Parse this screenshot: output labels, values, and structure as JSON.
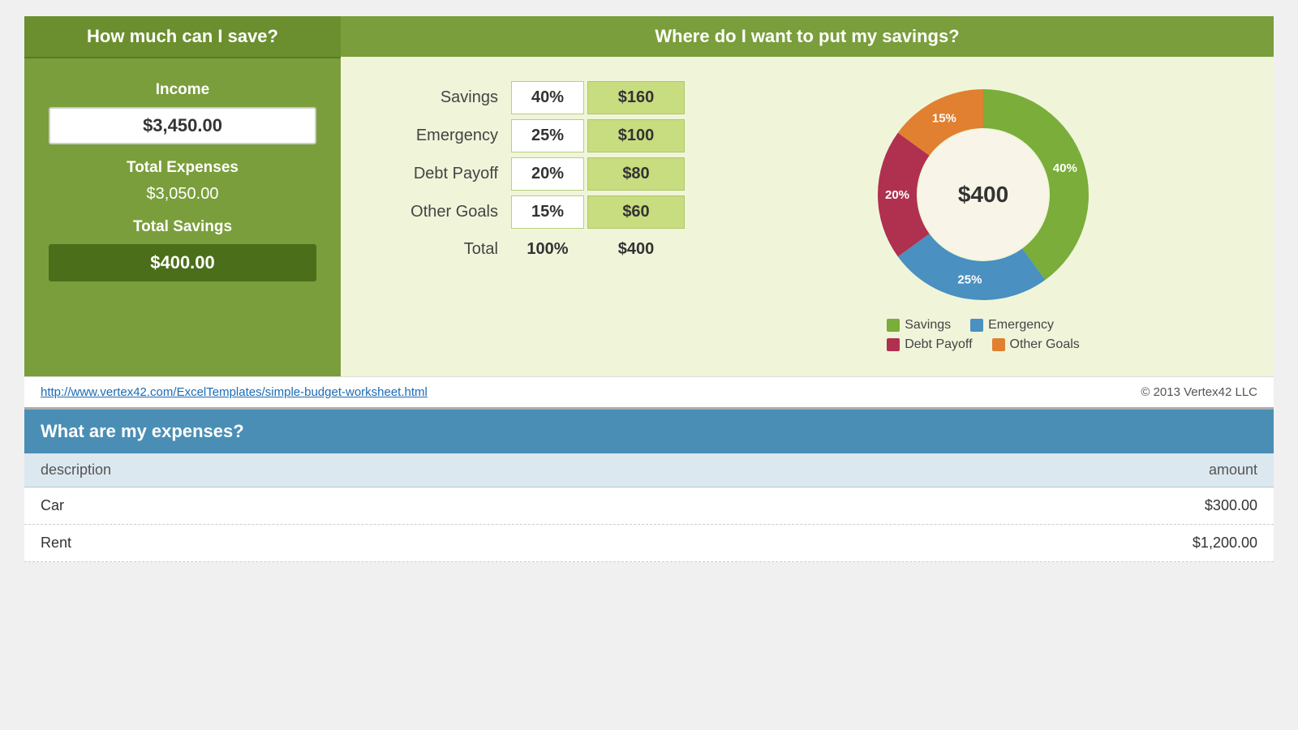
{
  "left_panel": {
    "header": "How much can I save?",
    "income_label": "Income",
    "income_value": "$3,450.00",
    "expenses_label": "Total Expenses",
    "expenses_value": "$3,050.00",
    "savings_label": "Total Savings",
    "savings_value": "$400.00"
  },
  "right_panel": {
    "header": "Where do I want to put my savings?",
    "rows": [
      {
        "label": "Savings",
        "pct": "40%",
        "amt": "$160"
      },
      {
        "label": "Emergency",
        "pct": "25%",
        "amt": "$100"
      },
      {
        "label": "Debt Payoff",
        "pct": "20%",
        "amt": "$80"
      },
      {
        "label": "Other Goals",
        "pct": "15%",
        "amt": "$60"
      },
      {
        "label": "Total",
        "pct": "100%",
        "amt": "$400"
      }
    ],
    "donut_center": "$400",
    "donut_segments": [
      {
        "label": "Savings",
        "pct": 40,
        "color": "#7aad3a",
        "pct_label": "40%"
      },
      {
        "label": "Emergency",
        "pct": 25,
        "color": "#4a90c0",
        "pct_label": "25%"
      },
      {
        "label": "Debt Payoff",
        "pct": 20,
        "color": "#b03050",
        "pct_label": "20%"
      },
      {
        "label": "Other Goals",
        "pct": 15,
        "color": "#e08030",
        "pct_label": "15%"
      }
    ],
    "legend": [
      {
        "label": "Savings",
        "color": "#7aad3a"
      },
      {
        "label": "Emergency",
        "color": "#4a90c0"
      },
      {
        "label": "Debt Payoff",
        "color": "#b03050"
      },
      {
        "label": "Other Goals",
        "color": "#e08030"
      }
    ]
  },
  "footer": {
    "link_text": "http://www.vertex42.com/ExcelTemplates/simple-budget-worksheet.html",
    "link_href": "http://www.vertex42.com/ExcelTemplates/simple-budget-worksheet.html",
    "copyright": "© 2013 Vertex42 LLC"
  },
  "expenses": {
    "header": "What are my expenses?",
    "col_description": "description",
    "col_amount": "amount",
    "rows": [
      {
        "desc": "Car",
        "amount": "$300.00"
      },
      {
        "desc": "Rent",
        "amount": "$1,200.00"
      }
    ]
  }
}
